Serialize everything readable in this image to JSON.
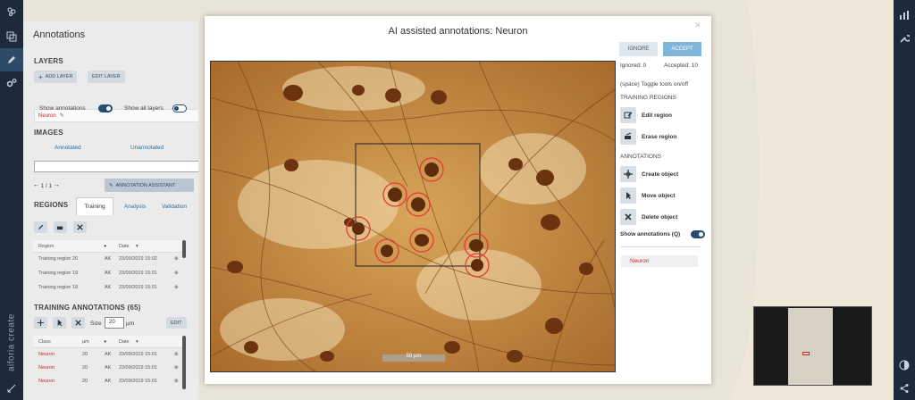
{
  "app": {
    "brand": "aiforia create"
  },
  "left_rail": {
    "icons": [
      "logo-icon",
      "windows-icon",
      "pencil-icon",
      "settings-icon",
      "expand-icon"
    ]
  },
  "right_rail": {
    "icons": [
      "chart-icon",
      "wrench-icon",
      "contrast-icon",
      "share-icon"
    ]
  },
  "panel": {
    "title": "Annotations",
    "layers": {
      "title": "LAYERS",
      "add_label": "ADD LAYER",
      "edit_label": "EDIT LAYER",
      "selected_layer": "Neuron",
      "show_annotations": "Show annotations",
      "show_all_layers": "Show all layers"
    },
    "images": {
      "title": "IMAGES",
      "annotated": "Annotated",
      "unannotated": "Unannotated",
      "pager": "1 / 1",
      "assistant_label": "ANNOTATION ASSISTANT"
    },
    "regions": {
      "title": "REGIONS",
      "tabs": [
        "Training",
        "Analysis",
        "Validation"
      ],
      "columns": [
        "Region",
        "Date"
      ],
      "rows": [
        {
          "name": "Training region 20",
          "user": "AK",
          "date": "23/09/2019 15:02"
        },
        {
          "name": "Training region 19",
          "user": "AK",
          "date": "23/09/2019 15:01"
        },
        {
          "name": "Training region 18",
          "user": "AK",
          "date": "23/09/2019 15:01"
        }
      ]
    },
    "training_annotations": {
      "title": "TRAINING ANNOTATIONS (65)",
      "size_label": "Size",
      "size_value": "20",
      "size_unit": "µm",
      "edit_label": "EDIT",
      "columns": [
        "Class",
        "µm",
        "Date"
      ],
      "rows": [
        {
          "cls": "Neuron",
          "um": "20",
          "user": "AK",
          "date": "23/09/2019 15:01"
        },
        {
          "cls": "Neuron",
          "um": "20",
          "user": "AK",
          "date": "23/09/2019 15:01"
        },
        {
          "cls": "Neuron",
          "um": "20",
          "user": "AK",
          "date": "23/09/2019 15:01"
        }
      ]
    }
  },
  "dialog": {
    "title": "AI assisted annotations: Neuron",
    "ignore_label": "IGNORE",
    "accept_label": "ACCEPT",
    "ignored": "Ignored: 0",
    "accepted": "Accepted: 10",
    "toggle_hint": "(space) Toggle tools on/off",
    "training_regions_title": "TRAINING REGIONS",
    "edit_region": "Edit region",
    "erase_region": "Erase region",
    "annotations_title": "ANNOTATIONS",
    "create_object": "Create object",
    "move_object": "Move object",
    "delete_object": "Delete object",
    "show_annotations": "Show annotations (Q)",
    "class_name": "Neuron",
    "scale_label": "50 µm"
  },
  "colors": {
    "accent": "#244d71",
    "neuron_red": "#c62828",
    "button_blue": "#7fb5d9"
  }
}
